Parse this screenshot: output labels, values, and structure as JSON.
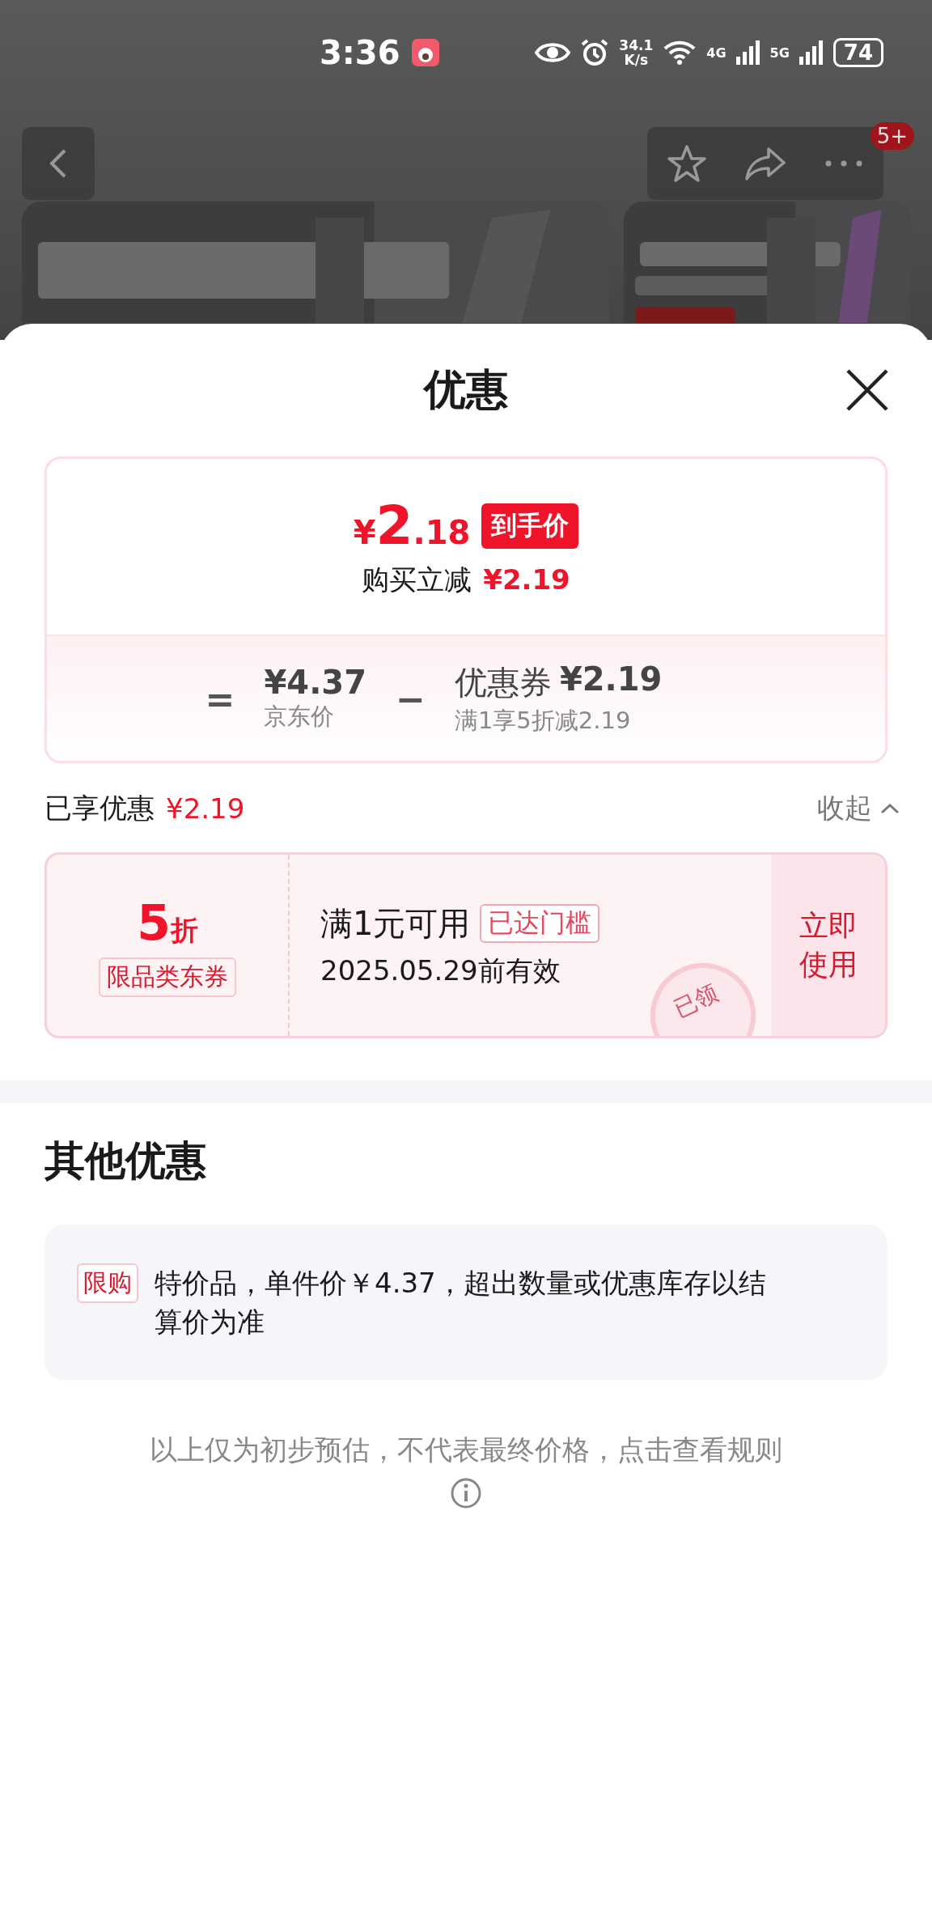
{
  "status_bar": {
    "time": "3:36",
    "speed_value": "34.1",
    "speed_unit": "K/s",
    "network_1": "4G",
    "network_2": "5G",
    "battery": "74"
  },
  "nav": {
    "badge": "5+"
  },
  "sheet": {
    "title": "优惠",
    "price_card": {
      "final_price_symbol": "¥",
      "final_price_int": "2",
      "final_price_dec": ".18",
      "final_price_tag": "到手价",
      "instant_cut_label": "购买立减",
      "instant_cut_value": "¥2.19",
      "equals": "=",
      "base_price": "¥4.37",
      "base_price_label": "京东价",
      "minus": "−",
      "coupon_label": "优惠券",
      "coupon_value": "¥2.19",
      "coupon_rule": "满1享5折减2.19"
    },
    "enjoyed": {
      "label": "已享优惠",
      "value": "¥2.19",
      "collapse": "收起"
    },
    "coupons": [
      {
        "discount": "5",
        "unit": "折",
        "type": "限品类东券",
        "condition": "满1元可用",
        "threshold_tag": "已达门槛",
        "validity": "2025.05.29前有效",
        "action": "立即使用",
        "stamp": "已领",
        "claimed": true
      }
    ],
    "other": {
      "title": "其他优惠",
      "items": [
        {
          "tag": "限购",
          "text": "特价品，单件价￥4.37，超出数量或优惠库存以结算价为准"
        }
      ]
    },
    "footer": "以上仅为初步预估，不代表最终价格，点击查看规则"
  }
}
